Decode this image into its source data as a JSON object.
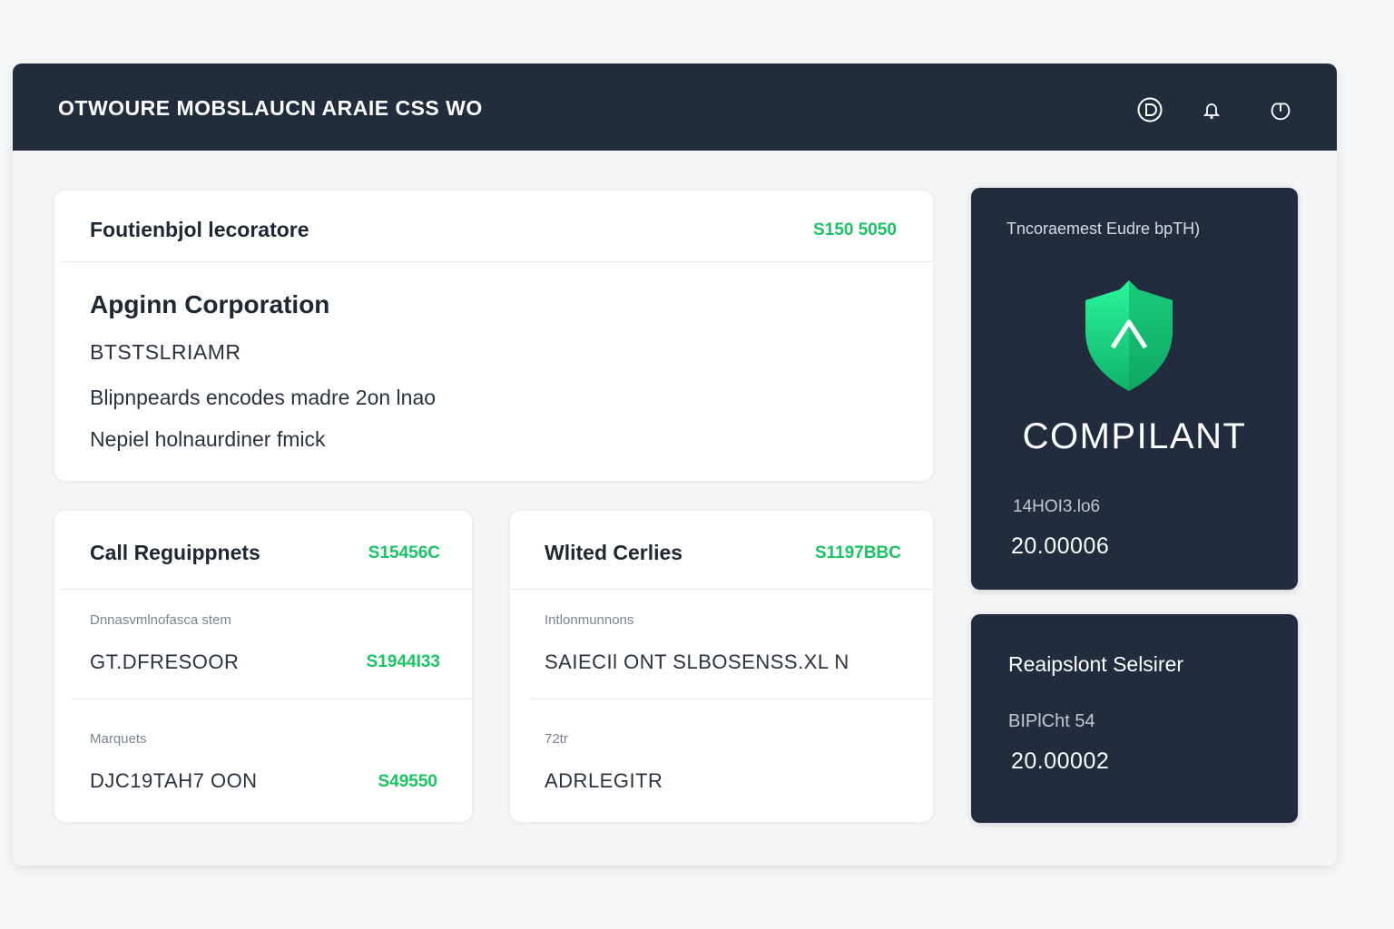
{
  "app": {
    "title": "OTWOURE MOBSLAUCN ARAIE CSS WO",
    "header_icons": [
      "user-circle-icon",
      "bell-icon",
      "power-icon"
    ]
  },
  "main_card": {
    "title": "Foutienbjol lecoratore",
    "amount": "S150 5050",
    "company": "Apginn Corporation",
    "code": "BTSTSLRIAMR",
    "line1": "Blipnpeards encodes madre 2on lnao",
    "line2": "Nepiel holnaurdiner fmick"
  },
  "card_left": {
    "title": "Call Reguippnets",
    "amount": "S15456C",
    "section1_label": "Dnnasvmlnofasca stem",
    "row1_value": "GT.DFRESOOR",
    "row1_amount": "S1944I33",
    "section2_label": "Marquets",
    "row2_value": "DJC19TAH7 OON",
    "row2_amount": "S49550"
  },
  "card_mid": {
    "title": "Wlited Cerlies",
    "amount": "S1197BBC",
    "section1_label": "Intlonmunnons",
    "row1_value": "SAIECIl ONT SLBOSENSS.XL N",
    "section2_label": "72tr",
    "row2_value": "ADRLEGITR"
  },
  "status_card": {
    "label": "Tncoraemest Eudre bpTH)",
    "shield_icon": "shield-check-icon",
    "status": "COMPILANT",
    "sub_label": "14HOI3.lo6",
    "value": "20.00006",
    "accent": "#1fe08a"
  },
  "report_card": {
    "title": "Reaipslont Selsirer",
    "sub_label": "BIPlCht 54",
    "value": "20.00002"
  }
}
